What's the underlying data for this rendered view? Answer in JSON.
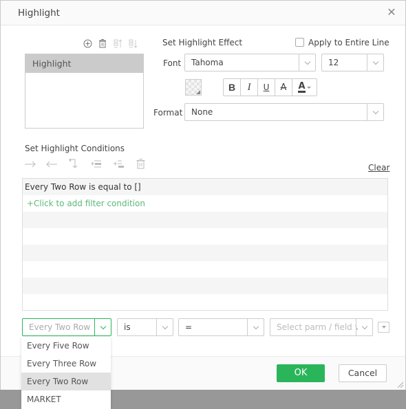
{
  "dialog": {
    "title": "Highlight",
    "close_icon": "close-icon"
  },
  "highlight_list": {
    "toolbar": [
      {
        "icon": "add-circle-icon",
        "enabled": true
      },
      {
        "icon": "trash-icon",
        "enabled": true
      },
      {
        "icon": "move-up-icon",
        "enabled": false
      },
      {
        "icon": "move-down-icon",
        "enabled": false
      }
    ],
    "items": [
      {
        "label": "Highlight",
        "selected": true
      }
    ]
  },
  "effect": {
    "section_label": "Set Highlight Effect",
    "apply_entire_line_label": "Apply to Entire Line",
    "apply_entire_line_checked": false,
    "font_label": "Font",
    "font_value": "Tahoma",
    "font_size_value": "12",
    "format_buttons": [
      "B",
      "I",
      "U",
      "A",
      "A"
    ],
    "format_label": "Format",
    "format_value": "None"
  },
  "conditions": {
    "section_label": "Set Highlight Conditions",
    "toolbar": [
      "indent-right-icon",
      "indent-left-icon",
      "return-icon",
      "insert-condition-icon",
      "append-condition-icon",
      "delete-icon"
    ],
    "clear_label": "Clear",
    "rows": [
      {
        "text": "Every Two Row is equal to []",
        "type": "condition"
      },
      {
        "text": "+Click to add filter condition",
        "type": "add"
      },
      {
        "text": "",
        "type": "empty"
      },
      {
        "text": "",
        "type": "empty"
      },
      {
        "text": "",
        "type": "empty"
      },
      {
        "text": "",
        "type": "empty"
      },
      {
        "text": "",
        "type": "empty"
      },
      {
        "text": "",
        "type": "empty"
      }
    ]
  },
  "filter_editor": {
    "field_value": "Every Two Row",
    "operator_value": "is",
    "comparison_value": "=",
    "value_placeholder": "Select parm / field valu",
    "field_options": [
      "Every Five Row",
      "Every Three Row",
      "Every Two Row",
      "MARKET"
    ],
    "field_selected": "Every Two Row"
  },
  "footer": {
    "ok_label": "OK",
    "cancel_label": "Cancel"
  },
  "colors": {
    "accent_green": "#2ab55a",
    "link_green": "#5cb87a",
    "selected_gray": "#cbcbcb"
  }
}
